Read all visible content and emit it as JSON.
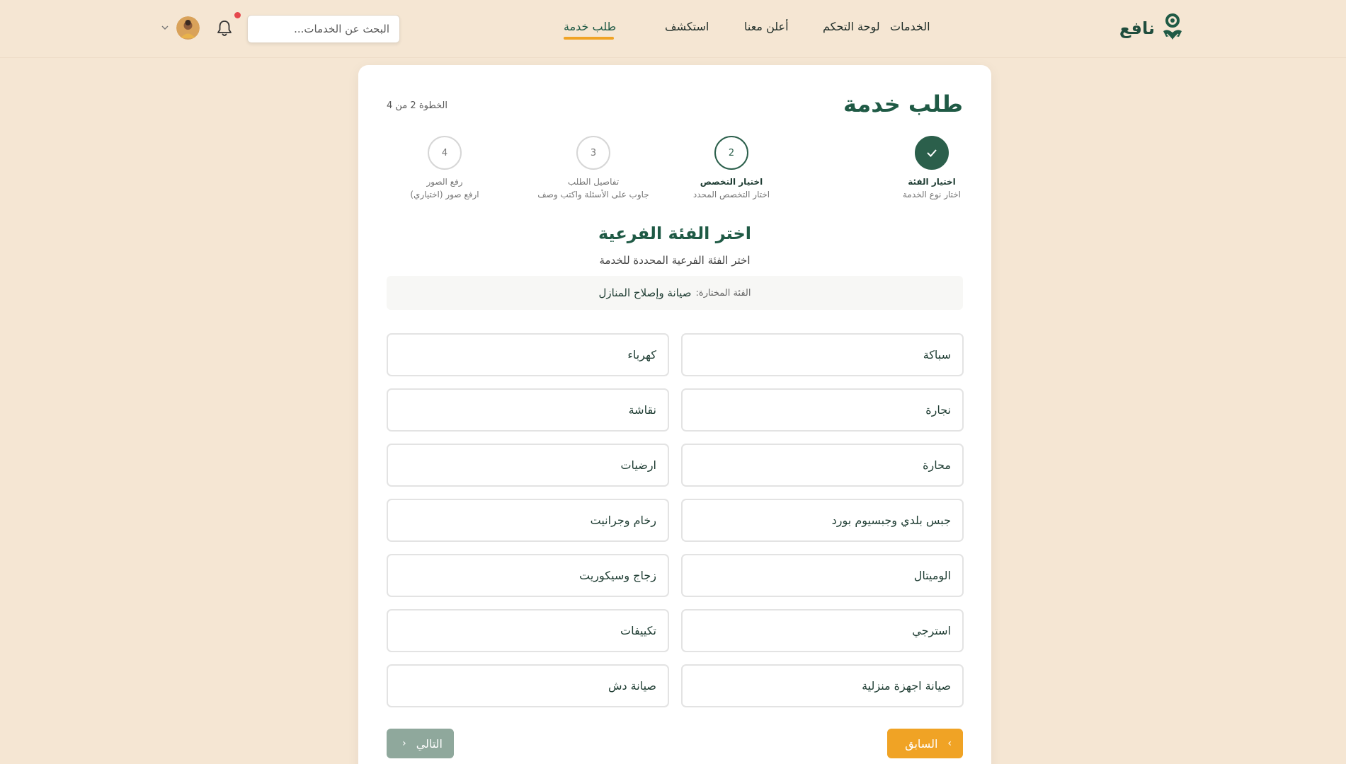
{
  "header": {
    "logo_text": "نافع",
    "nav": [
      {
        "label": "الخدمات"
      },
      {
        "label": "لوحة التحكم"
      },
      {
        "label": "أعلن معنا"
      },
      {
        "label": "استكشف"
      },
      {
        "label": "طلب خدمة",
        "active": true
      }
    ],
    "search_placeholder": "البحث عن الخدمات...",
    "accent_color": "#f0a325",
    "notification_color": "#e5484d"
  },
  "card": {
    "title": "طلب خدمة",
    "step_count": "الخطوة 2 من 4",
    "steps": [
      {
        "number": "",
        "title": "اختيار الفئة",
        "subtitle": "اختار نوع الخدمة",
        "state": "done"
      },
      {
        "number": "2",
        "title": "اختيار التخصص",
        "subtitle": "اختار التخصص المحدد",
        "state": "current"
      },
      {
        "number": "3",
        "title": "تفاصيل الطلب",
        "subtitle": "جاوب على الأسئلة واكتب وصف",
        "state": "pending"
      },
      {
        "number": "4",
        "title": "رفع الصور",
        "subtitle": "ارفع صور (اختياري)",
        "state": "pending"
      }
    ],
    "section_title": "اختر الفئة الفرعية",
    "section_subtitle": "اختر الفئة الفرعية المحددة للخدمة",
    "selected_label": "الفئة المختارة:",
    "selected_value": "صيانة وإصلاح المنازل",
    "options": [
      "سباكة",
      "كهرباء",
      "نجارة",
      "نقاشة",
      "محارة",
      "ارضيات",
      "جبس بلدي وجبسيوم بورد",
      "رخام وجرانيت",
      "الوميتال",
      "زجاج وسيكوريت",
      "استرجي",
      "تكييفات",
      "صيانة اجهزة منزلية",
      "صيانة دش"
    ],
    "prev_label": "السابق",
    "next_label": "التالي",
    "brand_color": "#2b5f4b"
  }
}
